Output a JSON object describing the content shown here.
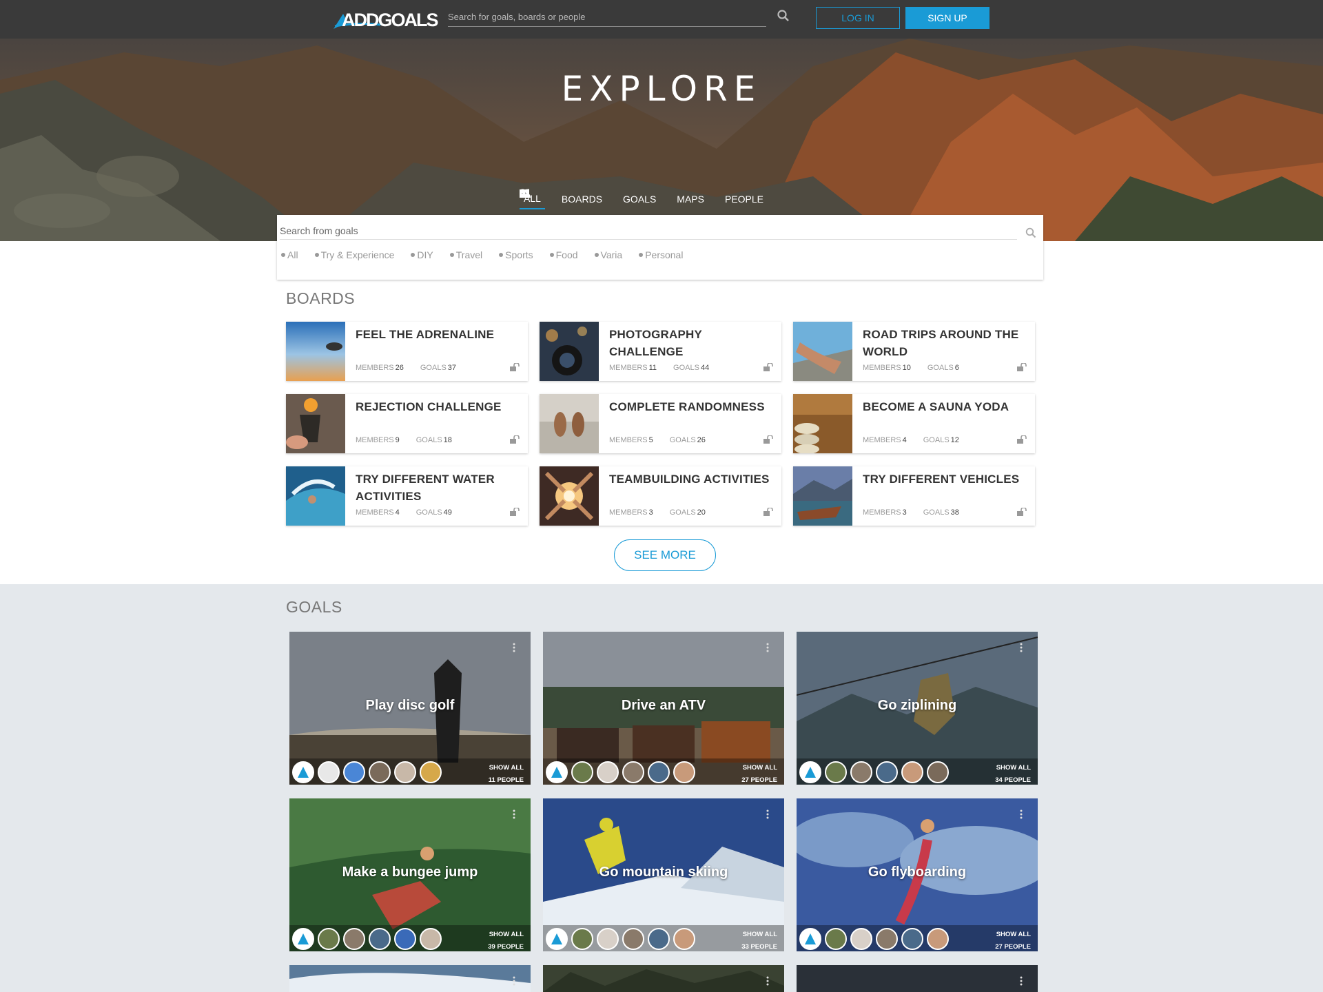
{
  "nav": {
    "logo_text": "ADDGOALS",
    "search_placeholder": "Search for goals, boards or people",
    "login_label": "LOG IN",
    "signup_label": "SIGN UP",
    "accent_color": "#1a9bd6"
  },
  "hero": {
    "title": "EXPLORE",
    "tabs": [
      {
        "label": "ALL",
        "icon": "flag-icon",
        "active": true
      },
      {
        "label": "BOARDS",
        "icon": "list-icon"
      },
      {
        "label": "GOALS",
        "icon": "rocket-icon"
      },
      {
        "label": "MAPS",
        "icon": "map-icon"
      },
      {
        "label": "PEOPLE",
        "icon": "people-icon"
      }
    ]
  },
  "search_panel": {
    "placeholder": "Search from goals",
    "filters": [
      "All",
      "Try & Experience",
      "DIY",
      "Travel",
      "Sports",
      "Food",
      "Varia",
      "Personal"
    ]
  },
  "boards": {
    "title": "BOARDS",
    "members_label": "MEMBERS",
    "goals_label": "GOALS",
    "items": [
      {
        "title": "FEEL THE ADRENALINE",
        "members": "26",
        "goals": "37"
      },
      {
        "title": "PHOTOGRAPHY CHALLENGE",
        "members": "11",
        "goals": "44"
      },
      {
        "title": "ROAD TRIPS AROUND THE WORLD",
        "members": "10",
        "goals": "6"
      },
      {
        "title": "REJECTION CHALLENGE",
        "members": "9",
        "goals": "18"
      },
      {
        "title": "COMPLETE RANDOMNESS",
        "members": "5",
        "goals": "26"
      },
      {
        "title": "BECOME A SAUNA YODA",
        "members": "4",
        "goals": "12"
      },
      {
        "title": "TRY DIFFERENT WATER ACTIVITIES",
        "members": "4",
        "goals": "49"
      },
      {
        "title": "TEAMBUILDING ACTIVITIES",
        "members": "3",
        "goals": "20"
      },
      {
        "title": "TRY DIFFERENT VEHICLES",
        "members": "3",
        "goals": "38"
      }
    ],
    "see_more_label": "SEE MORE"
  },
  "goals": {
    "title": "GOALS",
    "show_all_label": "SHOW ALL",
    "items": [
      {
        "title": "Play disc golf",
        "people": "11 PEOPLE"
      },
      {
        "title": "Drive an ATV",
        "people": "27 PEOPLE"
      },
      {
        "title": "Go ziplining",
        "people": "34 PEOPLE"
      },
      {
        "title": "Make a bungee jump",
        "people": "39 PEOPLE"
      },
      {
        "title": "Go mountain skiing",
        "people": "33 PEOPLE"
      },
      {
        "title": "Go flyboarding",
        "people": "27 PEOPLE"
      },
      {
        "title": "",
        "people": ""
      },
      {
        "title": "",
        "people": ""
      },
      {
        "title": "",
        "people": ""
      }
    ]
  }
}
